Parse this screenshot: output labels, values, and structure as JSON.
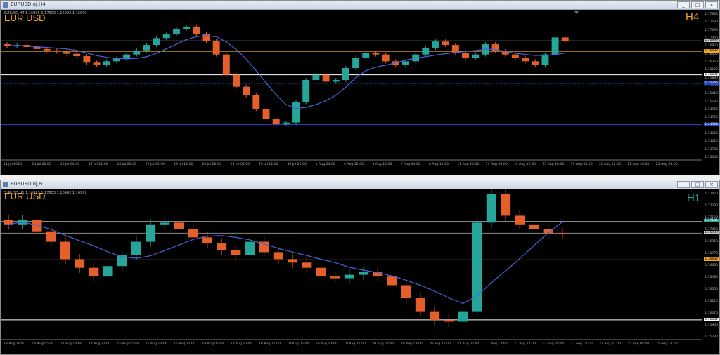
{
  "colors": {
    "bull": "#26a69a",
    "bear": "#e55f2b",
    "ma": "#4a63d8",
    "orange": "#f5a623",
    "gray": "#c8c8c8",
    "blue": "#2b48c8"
  },
  "top": {
    "title": "EURUSD.oj,H4",
    "symbol": "EUR USD",
    "timeframe": "H4",
    "ohlc": "EURUSD,H4  1.16995 1.17003 1.16992 1.16999",
    "price_ticks": [
      "1.17830",
      "1.17590",
      "1.17290",
      "1.17060",
      "1.16820",
      "1.16600",
      "1.16350",
      "1.16120",
      "1.15880",
      "1.15650",
      "1.15410",
      "1.15180",
      "1.14950",
      "1.14720",
      "1.14480",
      "1.14250",
      "1.14010",
      "1.13780",
      "1.13540"
    ],
    "price_boxes": {
      "current": "1.16999",
      "orange": "1.16692",
      "white": "1.16001",
      "blue1": "1.15745",
      "blue2": "1.14538"
    },
    "time_labels": [
      "11 Jul 2025",
      "14 Jul 20:00",
      "16 Jul 04:00",
      "17 Jul 12:00",
      "18 Jul 20:00",
      "22 Jul 04:00",
      "23 Jul 12:00",
      "24 Jul 20:00",
      "28 Jul 04:00",
      "29 Jul 12:00",
      "30 Jul 20:00",
      "1 Aug 04:00",
      "4 Aug 12:00",
      "5 Aug 20:00",
      "7 Aug 04:00",
      "8 Aug 12:00",
      "11 Aug 20:00",
      "13 Aug 04:00",
      "14 Aug 12:00",
      "15 Aug 20:00",
      "19 Aug 04:00",
      "20 Aug 12:00",
      "21 Aug 20:00",
      "25 Aug 04:00"
    ]
  },
  "bottom": {
    "title": "EURUSD.oj,H1",
    "symbol": "EUR USD",
    "timeframe": "H1",
    "ohlc": "EURUSD,H1  1.16995 1.17003 1.16992 1.16999",
    "price_ticks": [
      "1.17470",
      "1.17330",
      "1.17190",
      "1.17050",
      "1.16910",
      "1.16770",
      "1.16630",
      "1.16490",
      "1.16350",
      "1.16210",
      "1.16070",
      "1.15930",
      "1.15790"
    ],
    "price_boxes": {
      "gray": "1.17135",
      "current": "1.16999",
      "orange": "1.16692",
      "white": "1.16001"
    },
    "time_labels": [
      "13 Aug 2025",
      "14 Aug 05:00",
      "14 Aug 13:00",
      "14 Aug 21:00",
      "15 Aug 05:00",
      "15 Aug 13:00",
      "15 Aug 21:00",
      "18 Aug 05:00",
      "18 Aug 13:00",
      "18 Aug 21:00",
      "19 Aug 05:00",
      "19 Aug 13:00",
      "19 Aug 21:00",
      "20 Aug 05:00",
      "20 Aug 13:00",
      "20 Aug 21:00",
      "21 Aug 05:00",
      "21 Aug 13:00",
      "21 Aug 21:00",
      "22 Aug 05:00",
      "22 Aug 13:00",
      "22 Aug 21:00",
      "25 Aug 05:00",
      "25 Aug 13:00"
    ]
  },
  "window_buttons": {
    "minimize": "_",
    "restore": "□",
    "close": "×"
  },
  "chart_data": [
    {
      "type": "candlestick",
      "title": "EURUSD.oj,H4",
      "series": [
        {
          "name": "EUR USD H4",
          "close": [
            1.1685,
            1.1688,
            1.1682,
            1.1676,
            1.1672,
            1.1668,
            1.1662,
            1.1655,
            1.1636,
            1.1629,
            1.164,
            1.1648,
            1.166,
            1.1672,
            1.1688,
            1.1708,
            1.172,
            1.1735,
            1.1742,
            1.172,
            1.17,
            1.166,
            1.16,
            1.1565,
            1.154,
            1.15,
            1.147,
            1.1455,
            1.146,
            1.152,
            1.1585,
            1.16,
            1.158,
            1.1585,
            1.162,
            1.165,
            1.1665,
            1.166,
            1.164,
            1.163,
            1.164,
            1.166,
            1.168,
            1.1698,
            1.1688,
            1.1665,
            1.165,
            1.166,
            1.169,
            1.167,
            1.166,
            1.165,
            1.164,
            1.163,
            1.166,
            1.171,
            1.17
          ]
        }
      ],
      "reference_levels": [
        1.16692,
        1.16001,
        1.15745,
        1.14538
      ]
    },
    {
      "type": "candlestick",
      "title": "EURUSD.oj,H1",
      "series": [
        {
          "name": "EUR USD H1",
          "close": [
            1.171,
            1.1715,
            1.1702,
            1.169,
            1.167,
            1.166,
            1.165,
            1.1662,
            1.1675,
            1.169,
            1.171,
            1.1712,
            1.1705,
            1.1695,
            1.1688,
            1.168,
            1.1675,
            1.169,
            1.1678,
            1.167,
            1.1666,
            1.166,
            1.165,
            1.1648,
            1.1652,
            1.1655,
            1.165,
            1.164,
            1.1625,
            1.161,
            1.16,
            1.1598,
            1.161,
            1.1712,
            1.1745,
            1.172,
            1.171,
            1.1705,
            1.17,
            1.1699
          ]
        }
      ],
      "reference_levels": [
        1.17135,
        1.16692,
        1.16001
      ]
    }
  ]
}
